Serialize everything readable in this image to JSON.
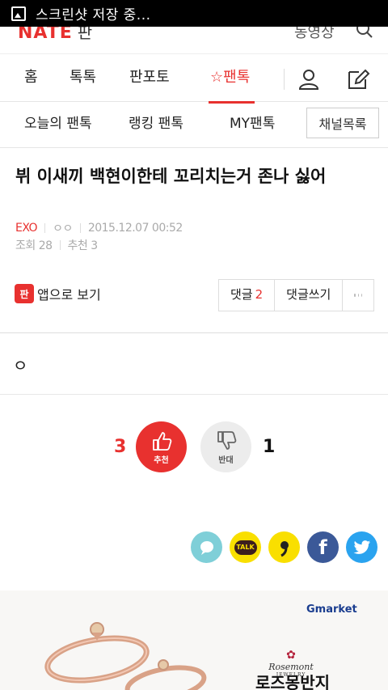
{
  "status_bar": {
    "text": "스크린샷 저장 중..."
  },
  "header": {
    "logo": "NATE",
    "logo_sub": "판",
    "top_link": "동영상"
  },
  "main_nav": {
    "items": [
      {
        "label": "홈"
      },
      {
        "label": "톡톡"
      },
      {
        "label": "판포토"
      },
      {
        "label": "팬톡",
        "active": true
      }
    ]
  },
  "sub_nav": {
    "items": [
      {
        "label": "오늘의 팬톡"
      },
      {
        "label": "랭킹 팬톡"
      },
      {
        "label": "MY팬톡"
      }
    ],
    "channel_button": "채널목록"
  },
  "article": {
    "title": "뷔 이새끼 백현이한테 꼬리치는거 존나 싫어",
    "category": "EXO",
    "author": "ㅇㅇ",
    "datetime": "2015.12.07 00:52",
    "views_label": "조회 28",
    "recommend_label": "추천 3",
    "body": "ㅇ"
  },
  "actions": {
    "app_view": "앱으로 보기",
    "app_icon_text": "판",
    "comments_label": "댓글",
    "comments_count": "2",
    "write_comment": "댓글쓰기"
  },
  "votes": {
    "up_count": "3",
    "up_label": "추천",
    "down_label": "반대",
    "down_count": "1"
  },
  "share": {
    "kakao_talk_label": "TALK",
    "facebook_label": "f"
  },
  "ad": {
    "advertiser": "Gmarket",
    "brand": "Rosemont",
    "brand_sub": "JEWELRY",
    "title": "로즈몽반지"
  },
  "colors": {
    "accent": "#e8312f",
    "facebook": "#3b5998",
    "twitter": "#2aa3ef",
    "kakao": "#f9df00",
    "story": "#7fcfd8"
  }
}
